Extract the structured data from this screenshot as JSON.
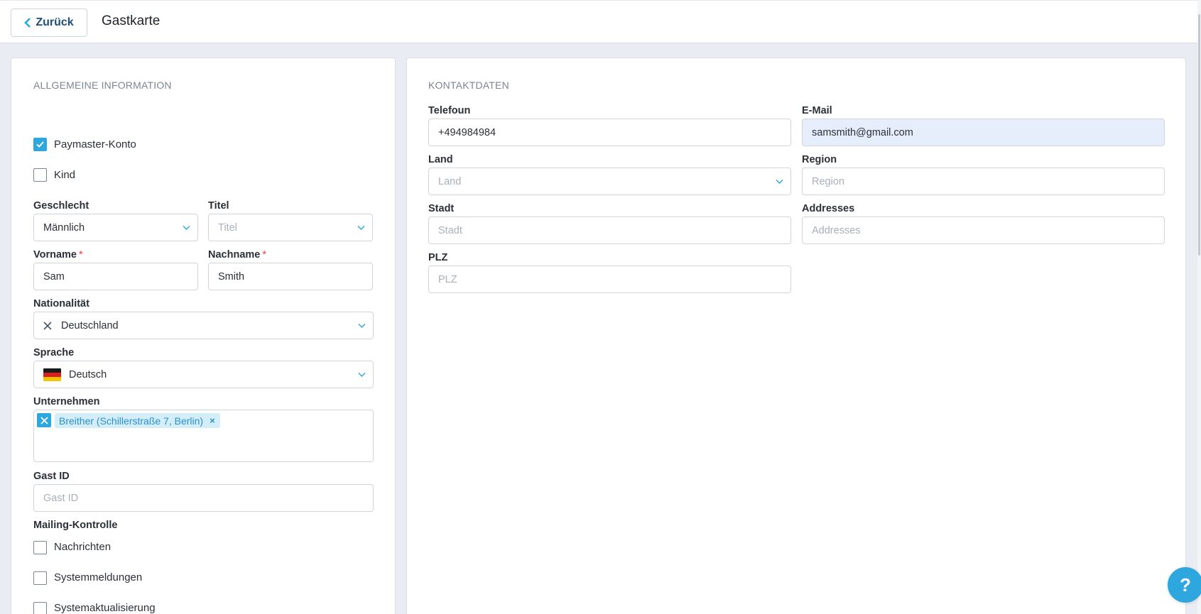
{
  "header": {
    "back_label": "Zurück",
    "title": "Gastkarte"
  },
  "general": {
    "section_title": "ALLGEMEINE INFORMATION",
    "paymaster": {
      "label": "Paymaster-Konto",
      "checked": true
    },
    "child": {
      "label": "Kind",
      "checked": false
    },
    "gender": {
      "label": "Geschlecht",
      "value": "Männlich"
    },
    "title_field": {
      "label": "Titel",
      "placeholder": "Titel"
    },
    "firstname": {
      "label": "Vorname",
      "value": "Sam",
      "required_mark": "*"
    },
    "lastname": {
      "label": "Nachname",
      "value": "Smith",
      "required_mark": "*"
    },
    "nationality": {
      "label": "Nationalität",
      "value": "Deutschland"
    },
    "language": {
      "label": "Sprache",
      "value": "Deutsch"
    },
    "company": {
      "label": "Unternehmen",
      "tags": [
        "Breither (Schillerstraße 7, Berlin)"
      ]
    },
    "guest_id": {
      "label": "Gast ID",
      "placeholder": "Gast ID"
    },
    "mailing": {
      "label": "Mailing-Kontrolle",
      "options": [
        {
          "label": "Nachrichten",
          "checked": false
        },
        {
          "label": "Systemmeldungen",
          "checked": false
        },
        {
          "label": "Systemaktualisierung",
          "checked": false
        }
      ]
    }
  },
  "contact": {
    "section_title": "KONTAKTDATEN",
    "phone": {
      "label": "Telefoun",
      "value": "+494984984"
    },
    "email": {
      "label": "E-Mail",
      "value": "samsmith@gmail.com"
    },
    "country": {
      "label": "Land",
      "placeholder": "Land"
    },
    "region": {
      "label": "Region",
      "placeholder": "Region"
    },
    "city": {
      "label": "Stadt",
      "placeholder": "Stadt"
    },
    "addresses": {
      "label": "Addresses",
      "placeholder": "Addresses"
    },
    "zip": {
      "label": "PLZ",
      "placeholder": "PLZ"
    }
  },
  "help": {
    "label": "?"
  },
  "colors": {
    "accent": "#2ea6de",
    "required": "#e0453a",
    "tag_bg": "#d4eef9",
    "page_bg": "#e9edf3"
  },
  "icons": {
    "back": "chevron-left-icon",
    "dropdown": "chevron-down-icon",
    "clear": "close-icon",
    "check": "check-icon",
    "language_flag": "german-flag-icon"
  }
}
